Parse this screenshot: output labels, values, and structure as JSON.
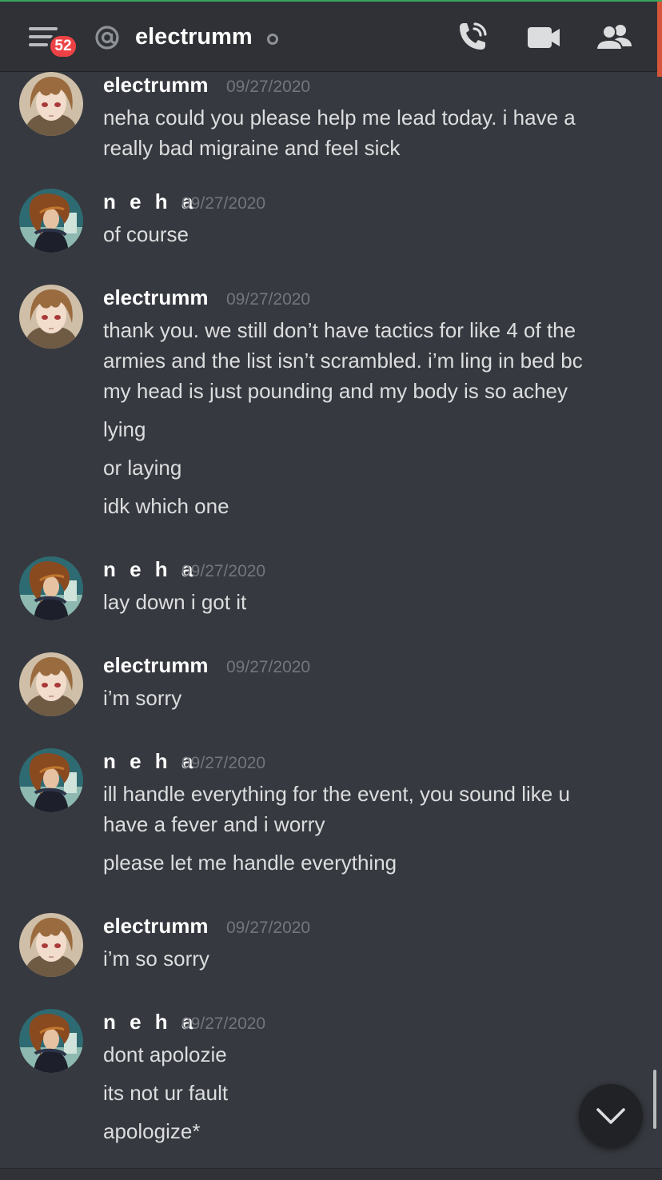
{
  "header": {
    "title": "electrumm",
    "unread_badge": "52",
    "icons": {
      "menu": "hamburger-menu-icon",
      "at": "at-sign-icon",
      "status": "offline-status-icon",
      "call": "phone-call-icon",
      "video": "video-camera-icon",
      "members": "members-icon"
    }
  },
  "colors": {
    "background": "#36393f",
    "header": "#2f3136",
    "badge": "#ed4245",
    "timestamp": "#72767d",
    "text": "#dcddde"
  },
  "messages": [
    {
      "author": "electrumm",
      "timestamp": "09/27/2020",
      "lines": [
        "neha could you please help me lead today. i have a",
        "really bad migraine and feel sick"
      ]
    },
    {
      "author": "n e h a",
      "timestamp": "09/27/2020",
      "lines": [
        "of course"
      ]
    },
    {
      "author": "electrumm",
      "timestamp": "09/27/2020",
      "lines": [
        "thank you. we still don’t have tactics for like 4 of the",
        "armies and the list isn’t scrambled. i’m ling in bed bc",
        "my head is just pounding and my body is so achey",
        "lying",
        "or laying",
        "idk which one"
      ]
    },
    {
      "author": "n e h a",
      "timestamp": "09/27/2020",
      "lines": [
        "lay down i got it"
      ]
    },
    {
      "author": "electrumm",
      "timestamp": "09/27/2020",
      "lines": [
        "i’m sorry"
      ]
    },
    {
      "author": "n e h a",
      "timestamp": "09/27/2020",
      "lines": [
        "ill handle everything for the event, you sound like u",
        "have a fever and i worry",
        "please let me handle everything"
      ]
    },
    {
      "author": "electrumm",
      "timestamp": "09/27/2020",
      "lines": [
        "i’m so sorry"
      ]
    },
    {
      "author": "n e h a",
      "timestamp": "09/27/2020",
      "lines": [
        "dont apolozie",
        "its not ur fault",
        "apologize*"
      ]
    }
  ],
  "jump_button_icon": "chevron-down-icon"
}
